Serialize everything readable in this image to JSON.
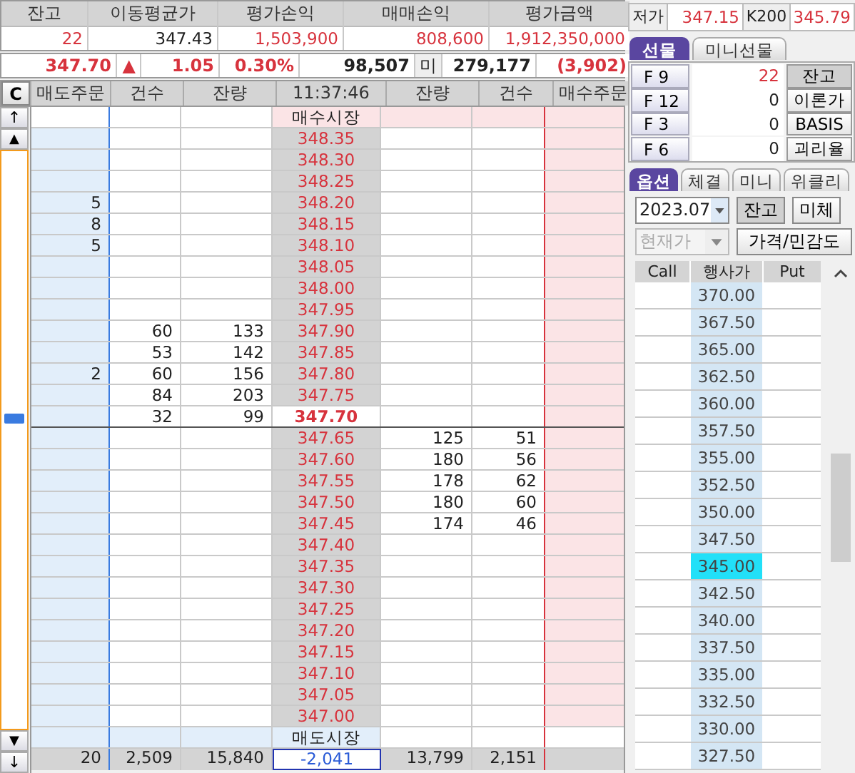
{
  "summary": {
    "columns": [
      "잔고",
      "이동평균가",
      "평가손익",
      "매매손익",
      "평가금액"
    ],
    "values": [
      {
        "text": "22",
        "up": true
      },
      {
        "text": "347.43",
        "up": false
      },
      {
        "text": "1,503,900",
        "up": true
      },
      {
        "text": "808,600",
        "up": true
      },
      {
        "text": "1,912,350,000",
        "up": true
      }
    ]
  },
  "quote": [
    {
      "kind": "value",
      "text": "347.70",
      "up": true
    },
    {
      "kind": "value",
      "text": "▲",
      "up": true
    },
    {
      "kind": "value",
      "text": "1.05",
      "up": true
    },
    {
      "kind": "value",
      "text": "0.30%",
      "up": true
    },
    {
      "kind": "value",
      "text": "98,507",
      "up": false
    },
    {
      "kind": "label",
      "text": "미",
      "up": false
    },
    {
      "kind": "value",
      "text": "279,177",
      "up": false
    },
    {
      "kind": "value",
      "text": "(3,902)",
      "up": true
    }
  ],
  "orderbook": {
    "clear_button": "C",
    "columns": [
      "매도주문",
      "건수",
      "잔량",
      "11:37:46",
      "잔량",
      "건수",
      "매수주문"
    ],
    "side_buttons": {
      "page_up": "↑",
      "up": "▲",
      "down": "▼",
      "page_down": "↓"
    },
    "rows": [
      {
        "kind": "buy-market",
        "price": "매수시장",
        "current": false
      },
      {
        "kind": "ask",
        "price": "348.35",
        "current": false
      },
      {
        "kind": "ask",
        "price": "348.30",
        "current": false
      },
      {
        "kind": "ask",
        "price": "348.25",
        "current": false
      },
      {
        "kind": "ask",
        "sell_order": "5",
        "price": "348.20",
        "current": false
      },
      {
        "kind": "ask",
        "sell_order": "8",
        "price": "348.15",
        "current": false
      },
      {
        "kind": "ask",
        "sell_order": "5",
        "price": "348.10",
        "current": false
      },
      {
        "kind": "ask",
        "price": "348.05",
        "current": false
      },
      {
        "kind": "ask",
        "price": "348.00",
        "current": false
      },
      {
        "kind": "ask",
        "price": "347.95",
        "current": false
      },
      {
        "kind": "ask",
        "sell_count": "60",
        "sell_qty": "133",
        "price": "347.90",
        "current": false
      },
      {
        "kind": "ask",
        "sell_count": "53",
        "sell_qty": "142",
        "price": "347.85",
        "current": false
      },
      {
        "kind": "ask",
        "sell_order": "2",
        "sell_count": "60",
        "sell_qty": "156",
        "price": "347.80",
        "current": false
      },
      {
        "kind": "ask",
        "sell_count": "84",
        "sell_qty": "203",
        "price": "347.75",
        "current": false
      },
      {
        "kind": "ask",
        "sell_count": "32",
        "sell_qty": "99",
        "price": "347.70",
        "current": true
      },
      {
        "kind": "bid",
        "price": "347.65",
        "buy_qty": "125",
        "buy_count": "51",
        "current": false
      },
      {
        "kind": "bid",
        "price": "347.60",
        "buy_qty": "180",
        "buy_count": "56",
        "current": false
      },
      {
        "kind": "bid",
        "price": "347.55",
        "buy_qty": "178",
        "buy_count": "62",
        "current": false
      },
      {
        "kind": "bid",
        "price": "347.50",
        "buy_qty": "180",
        "buy_count": "60",
        "current": false
      },
      {
        "kind": "bid",
        "price": "347.45",
        "buy_qty": "174",
        "buy_count": "46",
        "current": false
      },
      {
        "kind": "bid",
        "price": "347.40",
        "current": false
      },
      {
        "kind": "bid",
        "price": "347.35",
        "current": false
      },
      {
        "kind": "bid",
        "price": "347.30",
        "current": false
      },
      {
        "kind": "bid",
        "price": "347.25",
        "current": false
      },
      {
        "kind": "bid",
        "price": "347.20",
        "current": false
      },
      {
        "kind": "bid",
        "price": "347.15",
        "current": false
      },
      {
        "kind": "bid",
        "price": "347.10",
        "current": false
      },
      {
        "kind": "bid",
        "price": "347.05",
        "current": false
      },
      {
        "kind": "bid",
        "price": "347.00",
        "current": false
      },
      {
        "kind": "sell-market",
        "price": "매도시장",
        "current": false
      }
    ],
    "totals": [
      {
        "text": "20",
        "down": false
      },
      {
        "text": "2,509",
        "down": false
      },
      {
        "text": "15,840",
        "down": false
      },
      {
        "text": "-2,041",
        "down": true
      },
      {
        "text": "13,799",
        "down": false
      },
      {
        "text": "2,151",
        "down": false
      }
    ]
  },
  "stats": [
    {
      "label": "저가",
      "value": "347.15"
    },
    {
      "label": "K200",
      "value": "345.79"
    }
  ],
  "futures_tabs": [
    {
      "label": "선물",
      "selected": true
    },
    {
      "label": "미니선물",
      "selected": false
    }
  ],
  "futures_rows": [
    {
      "code": "F 9",
      "qty": "22",
      "up": true,
      "action": "잔고",
      "pressed": true
    },
    {
      "code": "F 12",
      "qty": "0",
      "up": false,
      "action": "이론가",
      "pressed": false
    },
    {
      "code": "F 3",
      "qty": "0",
      "up": false,
      "action": "BASIS",
      "pressed": false
    },
    {
      "code": "F 6",
      "qty": "0",
      "up": false,
      "action": "괴리율",
      "pressed": false
    }
  ],
  "option_tabs": [
    {
      "label": "옵션",
      "selected": true
    },
    {
      "label": "체결",
      "selected": false
    },
    {
      "label": "미니",
      "selected": false
    },
    {
      "label": "위클리",
      "selected": false
    }
  ],
  "month_select": {
    "value": "2023.07",
    "disabled": false
  },
  "balance_button": {
    "label": "잔고",
    "pressed": true
  },
  "unfilled_button": "미체",
  "price_type_select": {
    "value": "현재가",
    "disabled": true
  },
  "sensitivity_button": "가격/민감도",
  "options_table": {
    "columns": [
      "Call",
      "행사가",
      "Put"
    ],
    "rows": [
      {
        "strike": "370.00",
        "selected": false
      },
      {
        "strike": "367.50",
        "selected": false
      },
      {
        "strike": "365.00",
        "selected": false
      },
      {
        "strike": "362.50",
        "selected": false
      },
      {
        "strike": "360.00",
        "selected": false
      },
      {
        "strike": "357.50",
        "selected": false
      },
      {
        "strike": "355.00",
        "selected": false
      },
      {
        "strike": "352.50",
        "selected": false
      },
      {
        "strike": "350.00",
        "selected": false
      },
      {
        "strike": "347.50",
        "selected": false
      },
      {
        "strike": "345.00",
        "selected": true
      },
      {
        "strike": "342.50",
        "selected": false
      },
      {
        "strike": "340.00",
        "selected": false
      },
      {
        "strike": "337.50",
        "selected": false
      },
      {
        "strike": "335.00",
        "selected": false
      },
      {
        "strike": "332.50",
        "selected": false
      },
      {
        "strike": "330.00",
        "selected": false
      },
      {
        "strike": "327.50",
        "selected": false
      }
    ]
  }
}
